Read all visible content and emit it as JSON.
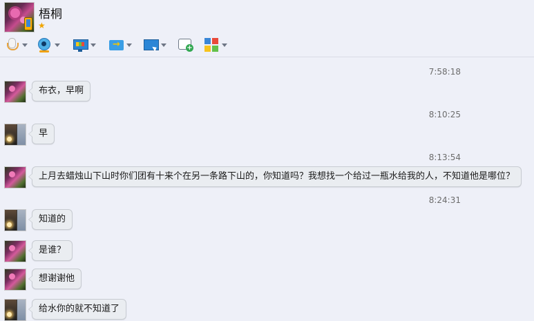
{
  "header": {
    "contact_name": "梧桐",
    "star_icon": "star-icon"
  },
  "toolbar": {
    "items": [
      {
        "icon": "microphone-icon"
      },
      {
        "icon": "webcam-icon"
      },
      {
        "icon": "screen-share-icon"
      },
      {
        "icon": "send-file-icon"
      },
      {
        "icon": "remote-assist-icon"
      },
      {
        "icon": "new-message-icon"
      },
      {
        "icon": "apps-grid-icon"
      }
    ]
  },
  "messages": [
    {
      "time": "7:58:18",
      "text": "布衣，早啊",
      "avatar": "pink-flower"
    },
    {
      "time": "8:10:25",
      "text": "早",
      "avatar": "dark"
    },
    {
      "time": "8:13:54",
      "text": "上月去蜡烛山下山时你们团有十来个在另一条路下山的，你知道吗？我想找一个给过一瓶水给我的人，不知道他是哪位？",
      "avatar": "pink-flower"
    },
    {
      "time": "8:24:31",
      "text": "知道的",
      "avatar": "dark"
    },
    {
      "time": "",
      "text": "是谁？",
      "avatar": "pink-flower"
    },
    {
      "time": "",
      "text": "想谢谢他",
      "avatar": "pink-flower"
    },
    {
      "time": "",
      "text": "给水你的就不知道了",
      "avatar": "dark"
    }
  ],
  "colors": {
    "background": "#eef0f8",
    "bubble": "#eaedf1",
    "timestamp": "#6c6c6c"
  }
}
